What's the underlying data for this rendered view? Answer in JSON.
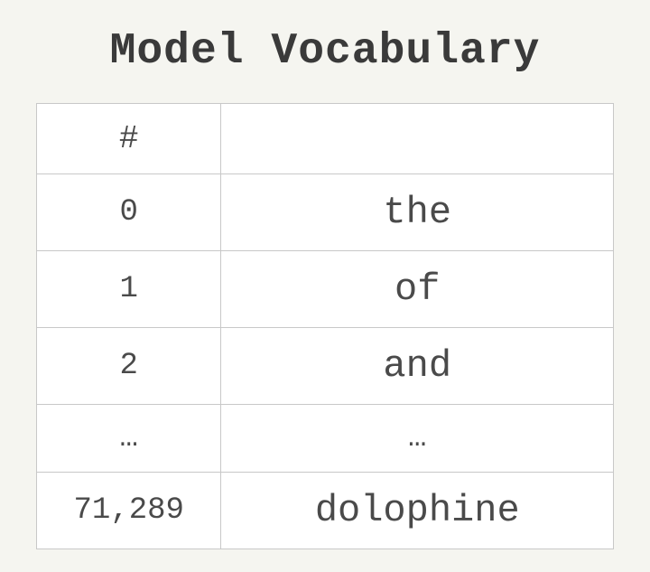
{
  "title": "Model Vocabulary",
  "table": {
    "headers": {
      "index": "#",
      "word": ""
    },
    "rows": [
      {
        "index": "0",
        "word": "the"
      },
      {
        "index": "1",
        "word": "of"
      },
      {
        "index": "2",
        "word": "and"
      },
      {
        "index": "…",
        "word": "…"
      },
      {
        "index": "71,289",
        "word": "dolophine"
      }
    ]
  }
}
